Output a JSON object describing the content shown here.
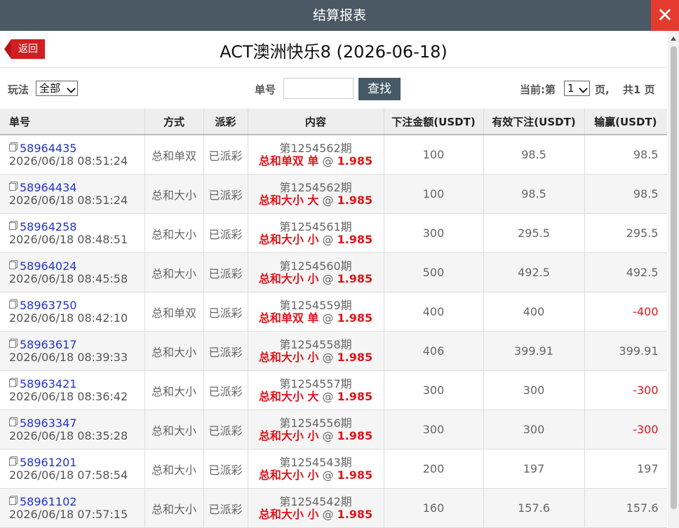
{
  "window": {
    "title": "结算报表",
    "close": "✕"
  },
  "header": {
    "back_label": "返回",
    "report_title": "ACT澳洲快乐8 (2026-06-18)"
  },
  "filters": {
    "play_label": "玩法",
    "play_value": "全部",
    "order_label": "单号",
    "search_label": "查找",
    "page_prefix": "当前:第",
    "page_value": "1",
    "page_suffix": "页,",
    "total_pages": "共1 页"
  },
  "table": {
    "columns": [
      "单号",
      "方式",
      "派彩",
      "内容",
      "下注金额(USDT)",
      "有效下注(USDT)",
      "输赢(USDT)"
    ],
    "rows": [
      {
        "order": "58964435",
        "time": "2026/06/18 08:51:24",
        "mode": "总和单双",
        "status": "已派彩",
        "period": "第1254562期",
        "bet": "总和单双 单",
        "odds": "1.985",
        "amount": "100",
        "valid": "98.5",
        "result": "98.5"
      },
      {
        "order": "58964434",
        "time": "2026/06/18 08:51:24",
        "mode": "总和大小",
        "status": "已派彩",
        "period": "第1254562期",
        "bet": "总和大小 大",
        "odds": "1.985",
        "amount": "100",
        "valid": "98.5",
        "result": "98.5"
      },
      {
        "order": "58964258",
        "time": "2026/06/18 08:48:51",
        "mode": "总和大小",
        "status": "已派彩",
        "period": "第1254561期",
        "bet": "总和大小 小",
        "odds": "1.985",
        "amount": "300",
        "valid": "295.5",
        "result": "295.5"
      },
      {
        "order": "58964024",
        "time": "2026/06/18 08:45:58",
        "mode": "总和大小",
        "status": "已派彩",
        "period": "第1254560期",
        "bet": "总和大小 小",
        "odds": "1.985",
        "amount": "500",
        "valid": "492.5",
        "result": "492.5"
      },
      {
        "order": "58963750",
        "time": "2026/06/18 08:42:10",
        "mode": "总和单双",
        "status": "已派彩",
        "period": "第1254559期",
        "bet": "总和单双 单",
        "odds": "1.985",
        "amount": "400",
        "valid": "400",
        "result": "-400"
      },
      {
        "order": "58963617",
        "time": "2026/06/18 08:39:33",
        "mode": "总和大小",
        "status": "已派彩",
        "period": "第1254558期",
        "bet": "总和大小 小",
        "odds": "1.985",
        "amount": "406",
        "valid": "399.91",
        "result": "399.91"
      },
      {
        "order": "58963421",
        "time": "2026/06/18 08:36:42",
        "mode": "总和大小",
        "status": "已派彩",
        "period": "第1254557期",
        "bet": "总和大小 大",
        "odds": "1.985",
        "amount": "300",
        "valid": "300",
        "result": "-300"
      },
      {
        "order": "58963347",
        "time": "2026/06/18 08:35:28",
        "mode": "总和大小",
        "status": "已派彩",
        "period": "第1254556期",
        "bet": "总和大小 小",
        "odds": "1.985",
        "amount": "300",
        "valid": "300",
        "result": "-300"
      },
      {
        "order": "58961201",
        "time": "2026/06/18 07:58:54",
        "mode": "总和大小",
        "status": "已派彩",
        "period": "第1254543期",
        "bet": "总和大小 小",
        "odds": "1.985",
        "amount": "200",
        "valid": "197",
        "result": "197"
      },
      {
        "order": "58961102",
        "time": "2026/06/18 07:57:15",
        "mode": "总和大小",
        "status": "已派彩",
        "period": "第1254542期",
        "bet": "总和大小 小",
        "odds": "1.985",
        "amount": "160",
        "valid": "157.6",
        "result": "157.6"
      }
    ]
  },
  "colors": {
    "titlebar": "#4a5964",
    "close": "#e53a2e",
    "link": "#2233cc",
    "accent_red": "#e0141a",
    "button": "#455966"
  },
  "icons": {
    "close": "close-icon",
    "back": "back-arrow-icon",
    "copy": "copy-icon",
    "select_caret": "chevron-down-icon"
  }
}
